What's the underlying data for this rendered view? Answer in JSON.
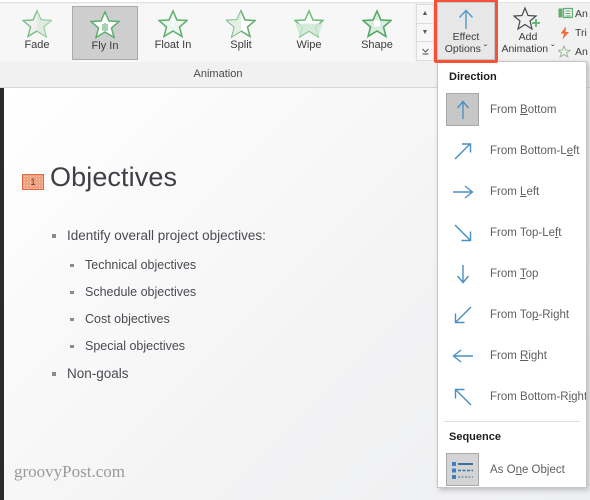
{
  "ribbon": {
    "group_label": "Animation",
    "gallery": [
      {
        "label": "Fade",
        "icon": "star-fade-icon",
        "selected": false
      },
      {
        "label": "Fly In",
        "icon": "star-fly-in-icon",
        "selected": true
      },
      {
        "label": "Float In",
        "icon": "star-float-in-icon",
        "selected": false
      },
      {
        "label": "Split",
        "icon": "star-split-icon",
        "selected": false
      },
      {
        "label": "Wipe",
        "icon": "star-wipe-icon",
        "selected": false
      },
      {
        "label": "Shape",
        "icon": "star-shape-icon",
        "selected": false
      }
    ],
    "gallery_scroll": {
      "up": "▲",
      "down": "▼",
      "more": "▼"
    },
    "effect_options": {
      "label_line1": "Effect",
      "label_line2": "Options",
      "dropdown_caret": "ˇ",
      "icon": "up-arrow-icon",
      "highlighted": true,
      "highlight_color": "#f4533a"
    },
    "add_animation": {
      "label_line1": "Add",
      "label_line2": "Animation",
      "dropdown_caret": "ˇ",
      "icon": "star-plus-icon"
    },
    "right_commands": [
      {
        "label": "An",
        "icon": "animation-pane-icon"
      },
      {
        "label": "Tri",
        "icon": "trigger-lightning-icon"
      },
      {
        "label": "An",
        "icon": "animation-painter-icon"
      }
    ]
  },
  "menu": {
    "direction_header": "Direction",
    "directions": [
      {
        "label_pre": "From ",
        "accel": "B",
        "label_post": "ottom",
        "full": "From Bottom",
        "icon": "arrow-up-icon",
        "selected": true
      },
      {
        "label_pre": "From Bottom-L",
        "accel": "e",
        "label_post": "ft",
        "full": "From Bottom-Left",
        "icon": "arrow-up-right-icon",
        "selected": false
      },
      {
        "label_pre": "From ",
        "accel": "L",
        "label_post": "eft",
        "full": "From Left",
        "icon": "arrow-right-icon",
        "selected": false
      },
      {
        "label_pre": "From Top-Le",
        "accel": "f",
        "label_post": "t",
        "full": "From Top-Left",
        "icon": "arrow-down-right-icon",
        "selected": false
      },
      {
        "label_pre": "From ",
        "accel": "T",
        "label_post": "op",
        "full": "From Top",
        "icon": "arrow-down-icon",
        "selected": false
      },
      {
        "label_pre": "From To",
        "accel": "p",
        "label_post": "-Right",
        "full": "From Top-Right",
        "icon": "arrow-down-left-icon",
        "selected": false
      },
      {
        "label_pre": "From ",
        "accel": "R",
        "label_post": "ight",
        "full": "From Right",
        "icon": "arrow-left-icon",
        "selected": false
      },
      {
        "label_pre": "From Bottom-R",
        "accel": "i",
        "label_post": "ght",
        "full": "From Bottom-Right",
        "icon": "arrow-up-left-icon",
        "selected": false
      }
    ],
    "sequence_header": "Sequence",
    "sequence": [
      {
        "label_pre": "As O",
        "accel": "n",
        "label_post": "e Object",
        "full": "As One Object",
        "icon": "as-one-object-icon",
        "selected": false
      }
    ]
  },
  "slide": {
    "animation_badge": "1",
    "title": "Objectives",
    "bullets": [
      {
        "level": 1,
        "text": "Identify overall project objectives:"
      },
      {
        "level": 2,
        "text": "Technical objectives"
      },
      {
        "level": 2,
        "text": "Schedule objectives"
      },
      {
        "level": 2,
        "text": "Cost objectives"
      },
      {
        "level": 2,
        "text": "Special objectives"
      },
      {
        "level": 1,
        "text": "Non-goals"
      }
    ],
    "watermark": "groovyPost.com"
  },
  "colors": {
    "accent_green": "#6cbb7a",
    "arrow_blue": "#4a90c4",
    "highlight_red": "#f4533a",
    "badge_orange": "#f0a27f"
  }
}
